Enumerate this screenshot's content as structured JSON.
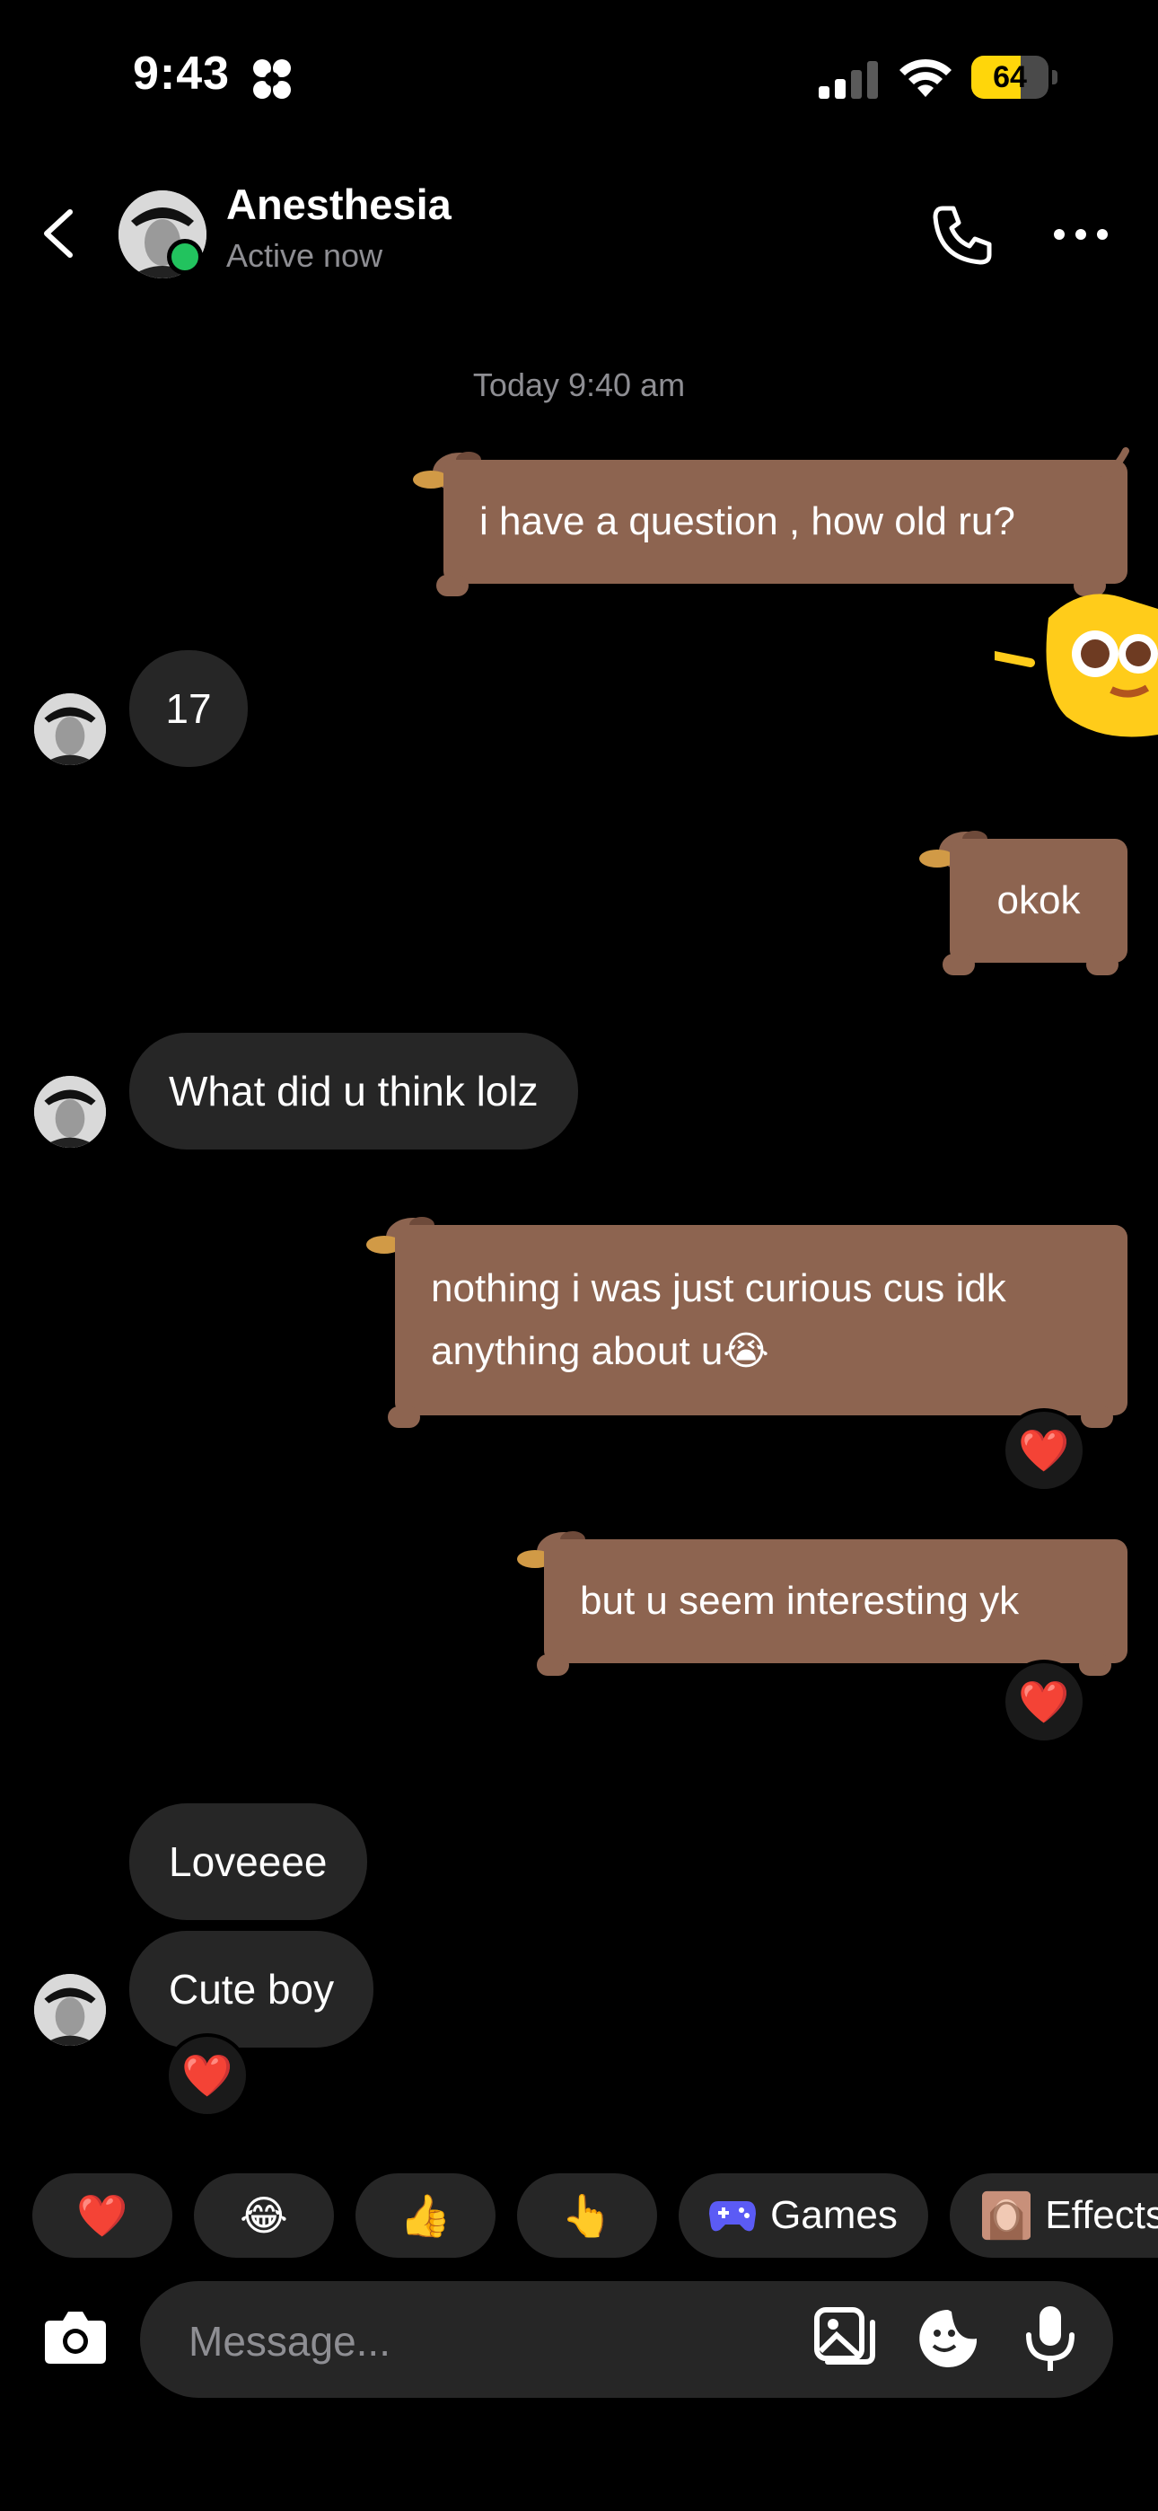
{
  "status_bar": {
    "time": "9:43",
    "battery": "64",
    "battery_level": 0.64
  },
  "header": {
    "contact_name": "Anesthesia",
    "contact_status": "Active now"
  },
  "conversation": {
    "timestamp": "Today 9:40 am",
    "messages": [
      {
        "from": "me",
        "text": "i have a question , how old ru?"
      },
      {
        "from": "them",
        "text": "17"
      },
      {
        "from": "me",
        "text": "okok"
      },
      {
        "from": "them",
        "text": "What did u think lolz"
      },
      {
        "from": "me",
        "text": "nothing i was just curious cus idk",
        "text2": "anything about u😭",
        "reaction": "❤️"
      },
      {
        "from": "me",
        "text": "but u seem interesting yk",
        "reaction": "❤️"
      },
      {
        "from": "them",
        "text": "Loveeee"
      },
      {
        "from": "them",
        "text": "Cute boy",
        "reaction": "❤️"
      }
    ]
  },
  "quick_actions": [
    {
      "emoji": "❤️"
    },
    {
      "emoji": "😂"
    },
    {
      "emoji": "👍"
    },
    {
      "emoji": "👆"
    },
    {
      "icon": "gamepad-icon",
      "label": "Games"
    },
    {
      "icon": "effects-avatar-icon",
      "label": "Effects"
    }
  ],
  "composer": {
    "placeholder": "Message..."
  },
  "colors": {
    "sent_bubble": "#8d6450",
    "received_bubble": "#262626",
    "online": "#22c35e",
    "battery": "#ffd60a"
  }
}
